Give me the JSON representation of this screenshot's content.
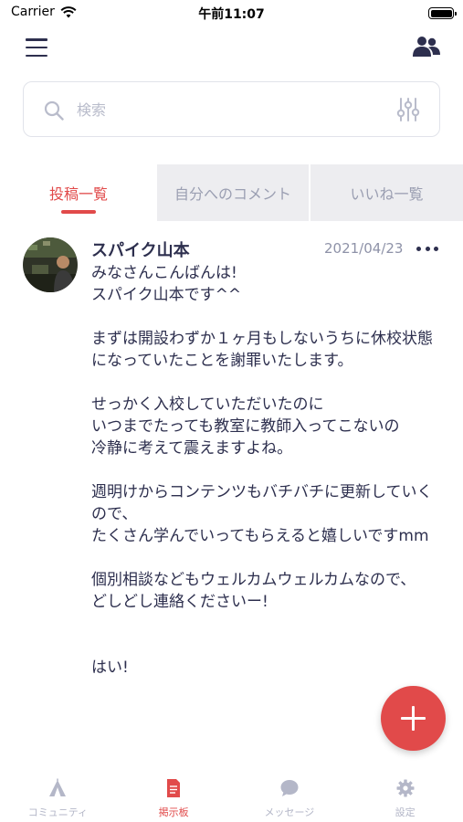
{
  "status_bar": {
    "carrier": "Carrier",
    "time": "午前11:07"
  },
  "header": {
    "menu_icon": "hamburger-icon",
    "right_icon": "people-icon"
  },
  "search": {
    "placeholder": "検索",
    "value": ""
  },
  "tabs": [
    {
      "label": "投稿一覧",
      "active": true
    },
    {
      "label": "自分へのコメント",
      "active": false
    },
    {
      "label": "いいね一覧",
      "active": false
    }
  ],
  "post": {
    "author": "スパイク山本",
    "date": "2021/04/23",
    "body": "みなさんこんばんは!\nスパイク山本です^^\n\nまずは開設わずか１ヶ月もしないうちに休校状態になっていたことを謝罪いたします。\n\nせっかく入校していただいたのに\nいつまでたっても教室に教師入ってこないの\n冷静に考えて震えますよね。\n\n週明けからコンテンツもバチバチに更新していくので、\nたくさん学んでいってもらえると嬉しいですmm\n\n個別相談などもウェルカムウェルカムなので、\nどしどし連絡くださいー!\n\n\nはい!"
  },
  "bottom_tabs": [
    {
      "label": "コミュニティ",
      "icon": "tent-icon",
      "active": false
    },
    {
      "label": "掲示板",
      "icon": "document-icon",
      "active": true
    },
    {
      "label": "メッセージ",
      "icon": "chat-bubble-icon",
      "active": false
    },
    {
      "label": "設定",
      "icon": "gear-icon",
      "active": false
    }
  ],
  "colors": {
    "accent": "#e14a4a",
    "text": "#2d2f4e",
    "muted": "#b4b7c8",
    "tab_bg": "#ededf0"
  }
}
